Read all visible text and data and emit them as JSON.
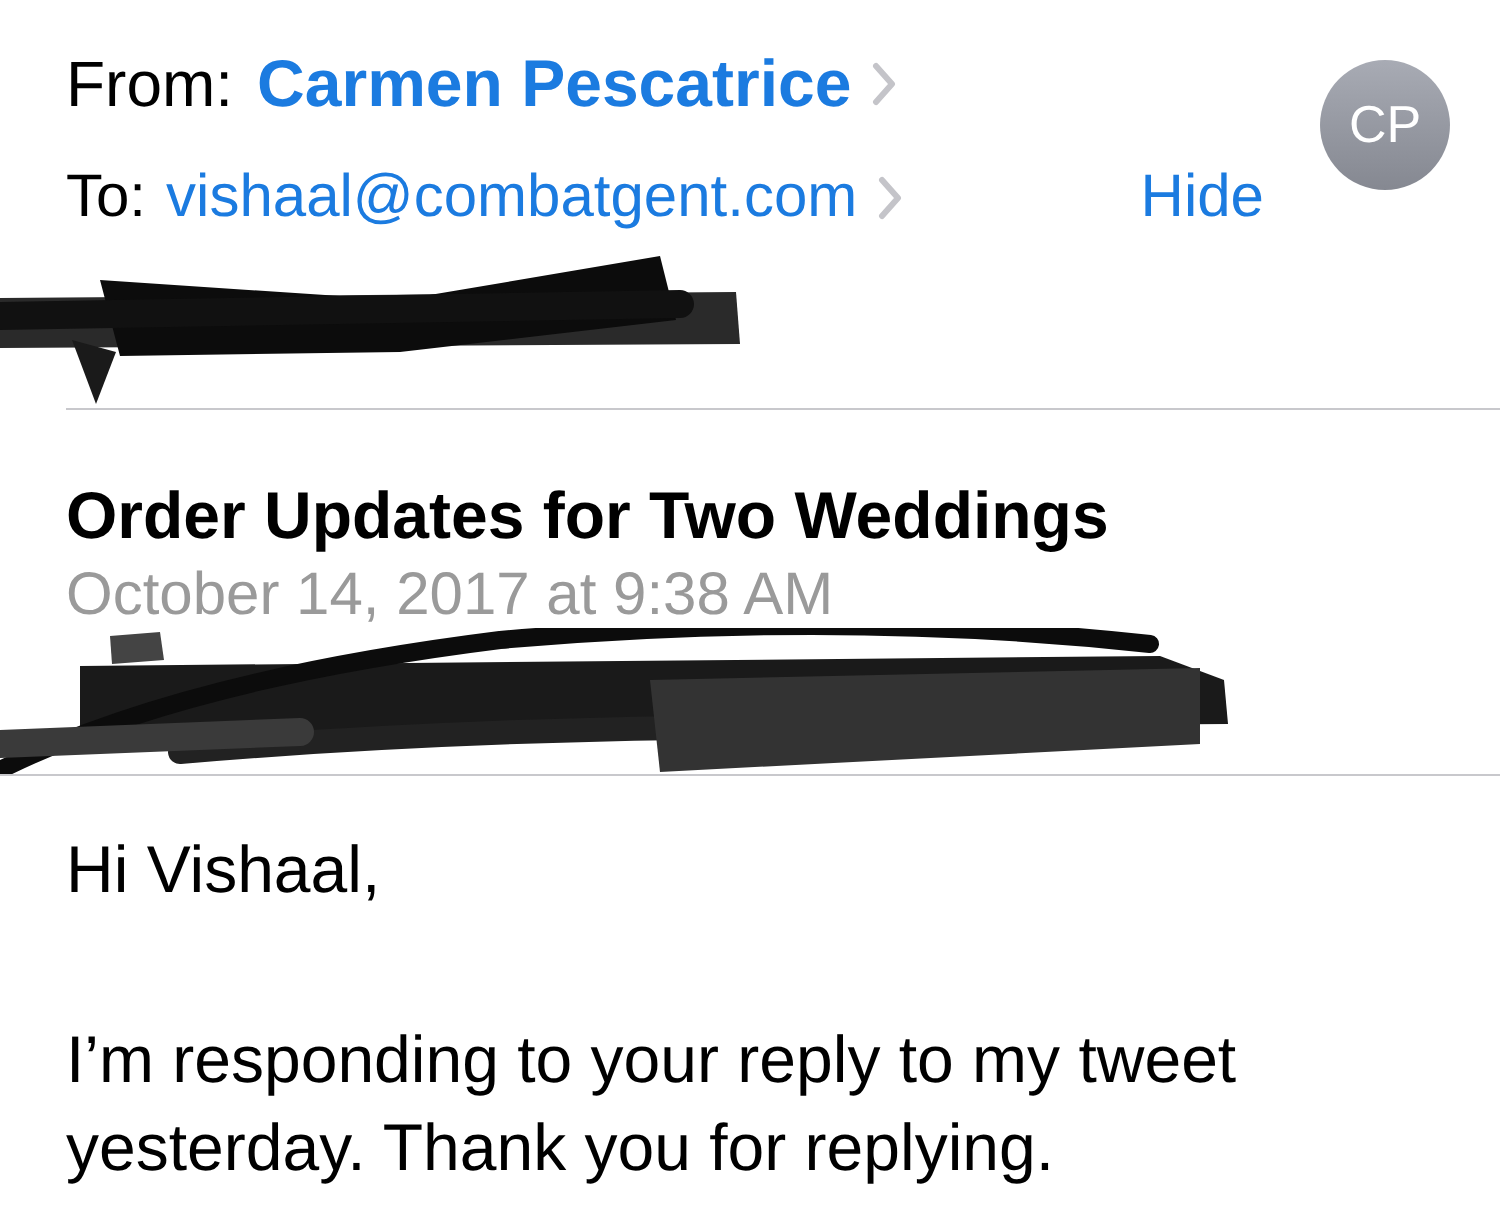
{
  "header": {
    "from": {
      "label": "From:",
      "name": "Carmen Pescatrice"
    },
    "to": {
      "label": "To:",
      "address": "vishaal@combatgent.com"
    },
    "hide_link": "Hide",
    "avatar": {
      "initials": "CP"
    }
  },
  "message": {
    "subject": "Order Updates for Two Weddings",
    "date": "October 14, 2017 at 9:38 AM"
  },
  "body": {
    "paragraphs": [
      "Hi Vishaal,",
      "I’m responding to your reply to my tweet yesterday. Thank you for replying."
    ]
  }
}
